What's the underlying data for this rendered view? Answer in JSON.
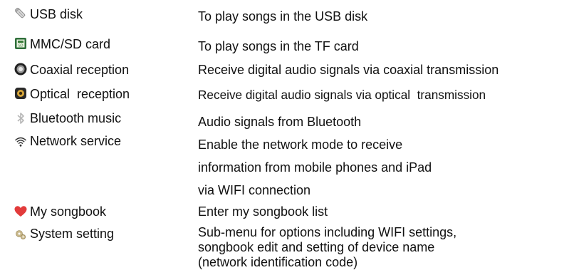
{
  "items": [
    {
      "name": "USB disk",
      "icon": "usb-disk-icon",
      "description": [
        "To play songs in the USB disk"
      ]
    },
    {
      "name": "MMC/SD card",
      "icon": "sd-card-icon",
      "description": [
        "To play songs in the TF card"
      ]
    },
    {
      "name": "Coaxial reception",
      "icon": "coaxial-icon",
      "description": [
        "Receive digital audio signals via coaxial transmission"
      ]
    },
    {
      "name": "Optical  reception",
      "icon": "optical-icon",
      "description": [
        "Receive digital audio signals via optical  transmission"
      ]
    },
    {
      "name": "Bluetooth music",
      "icon": "bluetooth-icon",
      "description": [
        "Audio signals from Bluetooth"
      ]
    },
    {
      "name": "Network service",
      "icon": "wifi-icon",
      "description": [
        "Enable the network mode to receive",
        "information from mobile phones and iPad",
        "via WIFI connection"
      ]
    },
    {
      "name": "My songbook",
      "icon": "heart-icon",
      "description": [
        "Enter my songbook list"
      ]
    },
    {
      "name": "System setting",
      "icon": "gear-icon",
      "description": [
        "Sub-menu for options including WIFI settings,",
        "songbook edit and setting of device name",
        "(network identification code)"
      ]
    }
  ],
  "colors": {
    "text": "#111111",
    "heart": "#e23b3b",
    "sd_card": "#3a7d3a",
    "disc": "#222222"
  }
}
